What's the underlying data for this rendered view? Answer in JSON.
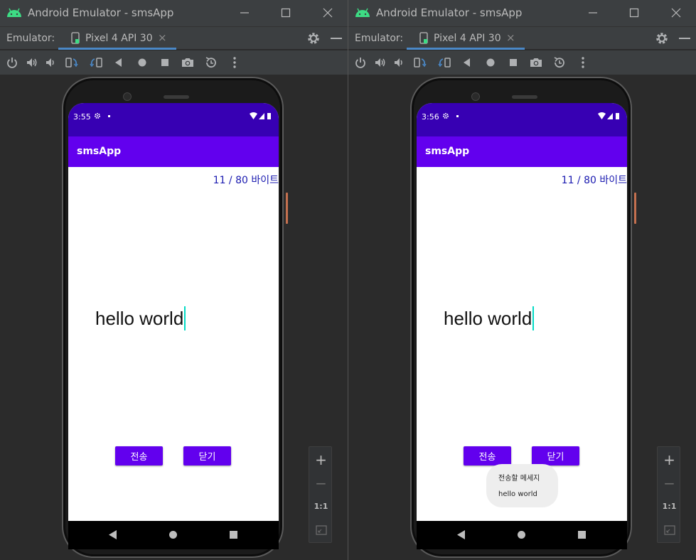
{
  "colors": {
    "accent_blue": "#4a88c7",
    "status_bar": "#3700b3",
    "app_bar": "#6200ee",
    "cursor": "#03dac5",
    "byte_counter": "#1a1ab0",
    "android_green": "#3ddc84"
  },
  "windows": [
    {
      "title": "Android Emulator - smsApp",
      "emulator_label": "Emulator:",
      "device_tab": "Pixel 4 API 30",
      "phone": {
        "time": "3:55",
        "app_title": "smsApp",
        "byte_counter": "11 / 80 바이트",
        "message": "hello world",
        "send_label": "전송",
        "close_label": "닫기"
      },
      "zoom": {
        "plus": "+",
        "minus": "−",
        "one_to_one": "1:1"
      }
    },
    {
      "title": "Android Emulator - smsApp",
      "emulator_label": "Emulator:",
      "device_tab": "Pixel 4 API 30",
      "phone": {
        "time": "3:56",
        "app_title": "smsApp",
        "byte_counter": "11 / 80 바이트",
        "message": "hello world",
        "send_label": "전송",
        "close_label": "닫기",
        "toast": {
          "line1": "전송할 메세지",
          "line2": "hello world"
        }
      },
      "zoom": {
        "plus": "+",
        "minus": "−",
        "one_to_one": "1:1"
      }
    }
  ],
  "icons": {
    "title_bar": [
      "android-logo-icon",
      "minimize-icon",
      "maximize-icon",
      "close-icon"
    ],
    "tab_bar": [
      "phone-icon",
      "tab-close-icon",
      "settings-gear-icon",
      "hide-panel-icon"
    ],
    "toolbar": [
      "power-icon",
      "volume-up-icon",
      "volume-down-icon",
      "rotate-left-icon",
      "rotate-right-icon",
      "back-icon",
      "home-icon",
      "overview-icon",
      "screenshot-camera-icon",
      "snapshot-icon",
      "more-vertical-icon"
    ],
    "status_bar": [
      "settings-icon",
      "wifi-icon",
      "signal-icon",
      "battery-icon"
    ],
    "nav_bar": [
      "nav-back-icon",
      "nav-home-icon",
      "nav-recents-icon"
    ]
  }
}
